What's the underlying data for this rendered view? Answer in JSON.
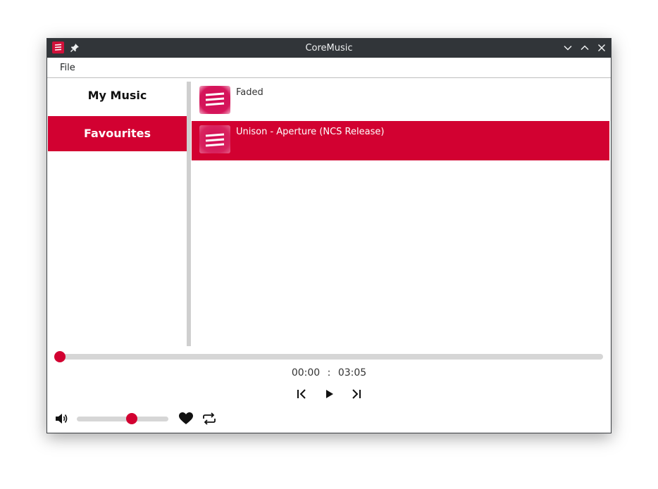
{
  "window": {
    "title": "CoreMusic",
    "icons": {
      "app": "coremusic-app-icon",
      "pin": "pin-icon",
      "minimize": "chevron-down-icon",
      "maximize": "chevron-up-icon",
      "close": "close-icon"
    }
  },
  "menubar": {
    "items": [
      {
        "label": "File"
      }
    ]
  },
  "sidebar": {
    "items": [
      {
        "label": "My Music",
        "selected": false
      },
      {
        "label": "Favourites",
        "selected": true
      }
    ]
  },
  "playlist": {
    "tracks": [
      {
        "title": "Faded",
        "selected": false
      },
      {
        "title": "Unison - Aperture (NCS Release)",
        "selected": true
      }
    ]
  },
  "player": {
    "current_time": "00:00",
    "separator": ":",
    "total_time": "03:05",
    "progress_fraction": 0.0,
    "volume_fraction": 0.6,
    "controls": [
      "previous-icon",
      "play-icon",
      "next-icon"
    ],
    "bottom_icons": [
      "volume-icon",
      "heart-icon",
      "repeat-icon"
    ]
  },
  "colors": {
    "accent": "#d20131",
    "titlebar": "#313539"
  }
}
